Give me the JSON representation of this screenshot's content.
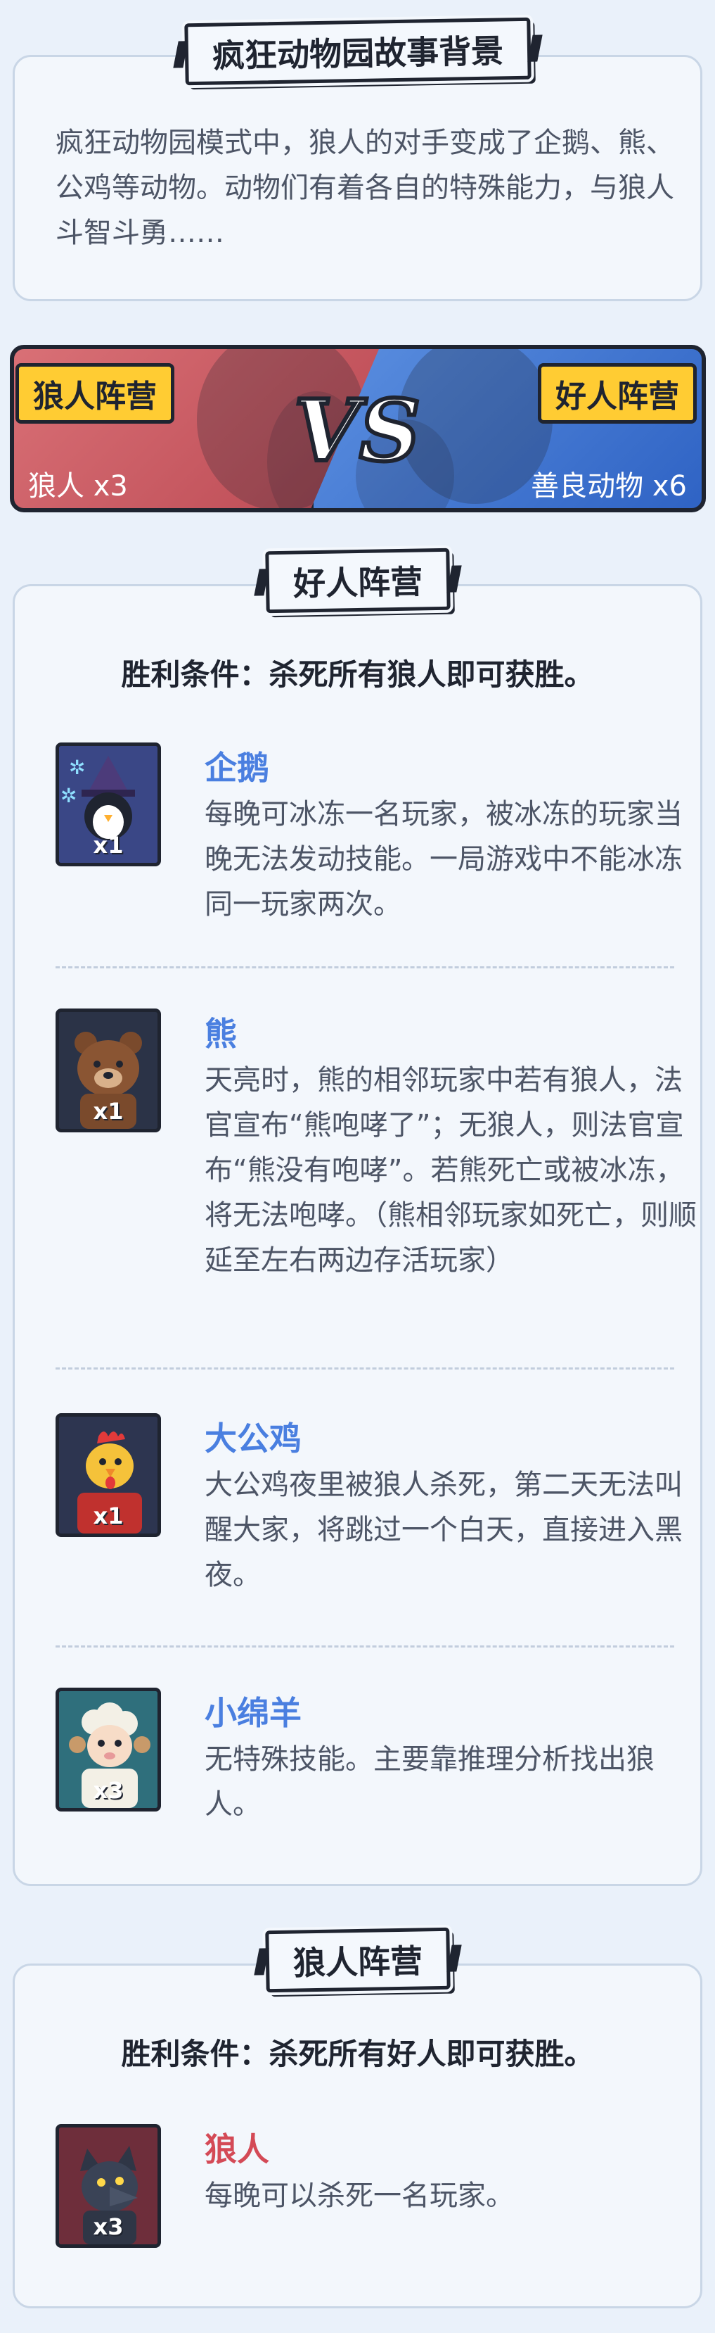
{
  "story": {
    "title": "疯狂动物园故事背景",
    "text": "疯狂动物园模式中，狼人的对手变成了企鹅、熊、公鸡等动物。动物们有着各自的特殊能力，与狼人斗智斗勇……"
  },
  "versus": {
    "left_label": "狼人阵营",
    "left_count": "狼人 x3",
    "vs_text": "VS",
    "right_label": "好人阵营",
    "right_count": "善良动物 x6"
  },
  "good_camp": {
    "title": "好人阵营",
    "win_condition": "胜利条件：杀死所有狼人即可获胜。",
    "roles": [
      {
        "name": "企鹅",
        "count": "x1",
        "desc": "每晚可冰冻一名玩家，被冰冻的玩家当晚无法发动技能。一局游戏中不能冰冻同一玩家两次。",
        "icon": "penguin-icon"
      },
      {
        "name": "熊",
        "count": "x1",
        "desc": "天亮时，熊的相邻玩家中若有狼人，法官宣布“熊咆哮了”；无狼人，则法官宣布“熊没有咆哮”。若熊死亡或被冰冻，将无法咆哮。（熊相邻玩家如死亡，则顺延至左右两边存活玩家）",
        "icon": "bear-icon"
      },
      {
        "name": "大公鸡",
        "count": "x1",
        "desc": "大公鸡夜里被狼人杀死，第二天无法叫醒大家，将跳过一个白天，直接进入黑夜。",
        "icon": "rooster-icon"
      },
      {
        "name": "小绵羊",
        "count": "x3",
        "desc": "无特殊技能。主要靠推理分析找出狼人。",
        "icon": "sheep-icon"
      }
    ]
  },
  "wolf_camp": {
    "title": "狼人阵营",
    "win_condition": "胜利条件：杀死所有好人即可获胜。",
    "roles": [
      {
        "name": "狼人",
        "count": "x3",
        "desc": "每晚可以杀死一名玩家。",
        "icon": "wolf-icon"
      }
    ]
  },
  "colors": {
    "good_accent": "#4a7fe0",
    "wolf_accent": "#d44a56",
    "label_yellow": "#ffcc33"
  }
}
